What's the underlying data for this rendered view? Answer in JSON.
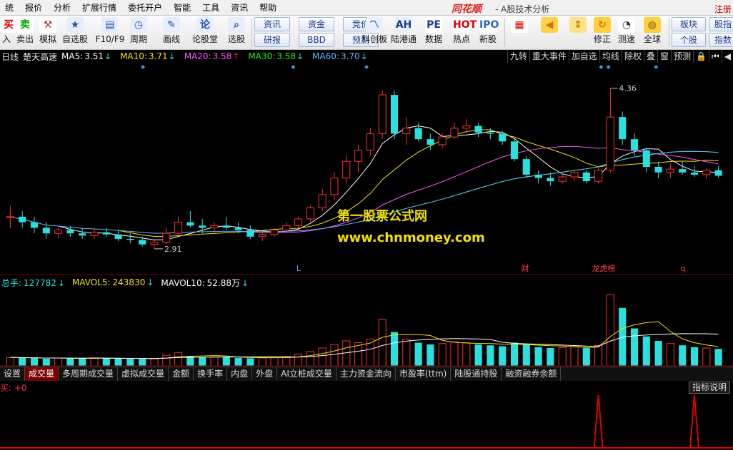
{
  "menu": [
    "统",
    "报价",
    "分析",
    "扩展行情",
    "委托开户",
    "智能",
    "工具",
    "资讯",
    "帮助"
  ],
  "brand": {
    "name": "同花顺",
    "subtitle": "- A股技术分析",
    "right_link": "注册"
  },
  "toolbar": {
    "left_buttons": [
      {
        "icon": "buy-icon",
        "glyph": "买",
        "label": "入"
      },
      {
        "icon": "sell-icon",
        "glyph": "卖",
        "label": "卖出"
      },
      {
        "icon": "hammer-icon",
        "glyph": "⚒",
        "label": "模拟"
      },
      {
        "icon": "star-icon",
        "glyph": "★",
        "label": "自选股"
      },
      {
        "icon": "f10-icon",
        "glyph": "▤",
        "label": "F10/F9"
      },
      {
        "icon": "clock-icon",
        "glyph": "◷",
        "label": "周期"
      },
      {
        "icon": "pencil-icon",
        "glyph": "✎",
        "label": "画线"
      },
      {
        "icon": "forum-icon",
        "glyph": "论",
        "label": "论股堂"
      },
      {
        "icon": "magnifier-icon",
        "glyph": "⌕",
        "label": "选股"
      }
    ],
    "small_buttons": [
      [
        "资讯",
        "研报"
      ],
      [
        "资金",
        "BBD"
      ],
      [
        "竞价",
        "预测"
      ]
    ],
    "right_buttons": [
      {
        "icon": "kcb-icon",
        "glyph": "〽",
        "label": "科创板"
      },
      {
        "icon": "ah-icon",
        "glyph": "AH",
        "label": "陆港通"
      },
      {
        "icon": "pe-icon",
        "glyph": "PE",
        "label": "数据"
      },
      {
        "icon": "hot-icon",
        "glyph": "HOT",
        "label": "热点"
      },
      {
        "icon": "ipo-icon",
        "glyph": "IPO",
        "label": "新股"
      }
    ],
    "nav_buttons": [
      {
        "icon": "grid-icon",
        "glyph": "▦",
        "label": ""
      },
      {
        "icon": "back-arrow-icon",
        "glyph": "◀",
        "label": ""
      },
      {
        "icon": "updown-icon",
        "glyph": "⇕",
        "label": ""
      },
      {
        "icon": "revise-icon",
        "glyph": "↻",
        "label": "修正"
      },
      {
        "icon": "speed-icon",
        "glyph": "◔",
        "label": "测速"
      },
      {
        "icon": "globe-icon",
        "glyph": "◍",
        "label": "全球"
      }
    ],
    "far_right": [
      [
        "板块",
        "个股"
      ],
      [
        "股指",
        "指数"
      ]
    ]
  },
  "kline": {
    "period": "日线",
    "name": "楚天高速",
    "ma": [
      {
        "label": "MA5:",
        "value": "3.51",
        "dir": "↓",
        "color": "#ffffff"
      },
      {
        "label": "MA10:",
        "value": "3.71",
        "dir": "↓",
        "color": "#f5e100"
      },
      {
        "label": "MA20:",
        "value": "3.58",
        "dir": "↑",
        "color": "#ff55ff"
      },
      {
        "label": "MA30:",
        "value": "3.58",
        "dir": "↓",
        "color": "#22ee22"
      },
      {
        "label": "MA60:",
        "value": "3.70",
        "dir": "↓",
        "color": "#55bbff"
      }
    ],
    "tabs": [
      "九转",
      "重大事件",
      "加自选",
      "均线",
      "除权",
      "叠",
      "窗",
      "预测",
      "🔒",
      "⏮",
      "◀"
    ],
    "high_label": "4.36",
    "low_label": "2.91",
    "event_marks": [
      {
        "text": "L",
        "color": "#5aa0ff"
      },
      {
        "text": "财",
        "color": "#ff4040"
      },
      {
        "text": "龙虎榜",
        "color": "#ff4040"
      },
      {
        "text": "q",
        "color": "#ff4040"
      }
    ],
    "colors": {
      "up": "#ff3030",
      "down": "#28e0e0"
    }
  },
  "watermark": {
    "line1": "第一股票公式网",
    "line2": "www.chnmoney.com"
  },
  "volume": {
    "items": [
      {
        "label": "总手:",
        "value": "127782",
        "dir": "↓",
        "color": "#28e0e0"
      },
      {
        "label": "MAVOL5:",
        "value": "243830",
        "dir": "↓",
        "color": "#f5e100"
      },
      {
        "label": "MAVOL10:",
        "value": "52.88万",
        "dir": "↓",
        "color": "#ffffff"
      }
    ]
  },
  "indicator_tabs": [
    "设置",
    "成交量",
    "多周期成交量",
    "虚拟成交量",
    "金额",
    "换手率",
    "内盘",
    "外盘",
    "AI立桩成交量",
    "主力资金流向",
    "市盈率(ttm)",
    "陆股通持股",
    "融资融券余额"
  ],
  "indicator": {
    "label": "买: +0",
    "desc_button": "指标说明"
  },
  "chart_data": {
    "type": "candlestick",
    "ohlc": [
      [
        3.2,
        3.3,
        3.1,
        3.2
      ],
      [
        3.2,
        3.25,
        3.1,
        3.15
      ],
      [
        3.15,
        3.2,
        3.05,
        3.1
      ],
      [
        3.1,
        3.15,
        3.0,
        3.05
      ],
      [
        3.05,
        3.1,
        3.0,
        3.08
      ],
      [
        3.08,
        3.12,
        3.02,
        3.05
      ],
      [
        3.05,
        3.1,
        3.0,
        3.03
      ],
      [
        3.03,
        3.1,
        3.0,
        3.06
      ],
      [
        3.06,
        3.1,
        3.02,
        3.04
      ],
      [
        3.04,
        3.08,
        2.98,
        3.0
      ],
      [
        3.0,
        3.05,
        2.96,
        2.99
      ],
      [
        2.99,
        3.02,
        2.93,
        2.95
      ],
      [
        2.95,
        3.0,
        2.91,
        2.97
      ],
      [
        2.97,
        3.1,
        2.95,
        3.05
      ],
      [
        3.05,
        3.2,
        3.03,
        3.15
      ],
      [
        3.15,
        3.25,
        3.1,
        3.12
      ],
      [
        3.12,
        3.18,
        3.05,
        3.1
      ],
      [
        3.1,
        3.15,
        3.05,
        3.12
      ],
      [
        3.12,
        3.2,
        3.08,
        3.1
      ],
      [
        3.1,
        3.15,
        3.05,
        3.08
      ],
      [
        3.08,
        3.12,
        3.0,
        3.02
      ],
      [
        3.02,
        3.06,
        2.98,
        3.04
      ],
      [
        3.04,
        3.1,
        3.02,
        3.08
      ],
      [
        3.08,
        3.15,
        3.06,
        3.12
      ],
      [
        3.12,
        3.2,
        3.1,
        3.18
      ],
      [
        3.18,
        3.3,
        3.15,
        3.28
      ],
      [
        3.28,
        3.45,
        3.25,
        3.4
      ],
      [
        3.4,
        3.6,
        3.35,
        3.55
      ],
      [
        3.55,
        3.75,
        3.5,
        3.7
      ],
      [
        3.7,
        3.85,
        3.6,
        3.8
      ],
      [
        3.8,
        4.0,
        3.75,
        3.95
      ],
      [
        3.95,
        4.34,
        3.9,
        4.3
      ],
      [
        4.3,
        4.34,
        3.9,
        3.95
      ],
      [
        3.95,
        4.1,
        3.85,
        4.0
      ],
      [
        4.0,
        4.05,
        3.88,
        3.9
      ],
      [
        3.9,
        3.95,
        3.8,
        3.85
      ],
      [
        3.85,
        3.95,
        3.82,
        3.92
      ],
      [
        3.92,
        4.05,
        3.9,
        4.0
      ],
      [
        4.0,
        4.08,
        3.95,
        4.02
      ],
      [
        4.02,
        4.05,
        3.92,
        3.96
      ],
      [
        3.96,
        4.0,
        3.9,
        3.95
      ],
      [
        3.95,
        3.98,
        3.85,
        3.88
      ],
      [
        3.88,
        3.9,
        3.7,
        3.72
      ],
      [
        3.72,
        3.75,
        3.55,
        3.58
      ],
      [
        3.58,
        3.62,
        3.5,
        3.55
      ],
      [
        3.55,
        3.6,
        3.48,
        3.52
      ],
      [
        3.52,
        3.58,
        3.5,
        3.56
      ],
      [
        3.56,
        3.62,
        3.52,
        3.6
      ],
      [
        3.6,
        3.62,
        3.5,
        3.52
      ],
      [
        3.52,
        3.65,
        3.5,
        3.62
      ],
      [
        3.62,
        4.36,
        3.6,
        4.1
      ],
      [
        4.1,
        4.15,
        3.85,
        3.9
      ],
      [
        3.9,
        3.95,
        3.75,
        3.8
      ],
      [
        3.8,
        3.82,
        3.6,
        3.65
      ],
      [
        3.65,
        3.7,
        3.55,
        3.6
      ],
      [
        3.6,
        3.68,
        3.55,
        3.63
      ],
      [
        3.63,
        3.7,
        3.58,
        3.6
      ],
      [
        3.6,
        3.66,
        3.56,
        3.58
      ],
      [
        3.58,
        3.64,
        3.54,
        3.62
      ],
      [
        3.62,
        3.66,
        3.55,
        3.57
      ]
    ],
    "volume": [
      95,
      90,
      85,
      80,
      88,
      82,
      86,
      90,
      84,
      80,
      78,
      76,
      82,
      120,
      150,
      110,
      95,
      100,
      98,
      90,
      85,
      88,
      92,
      105,
      130,
      160,
      200,
      240,
      280,
      260,
      300,
      520,
      380,
      300,
      260,
      240,
      250,
      270,
      260,
      240,
      230,
      220,
      260,
      240,
      210,
      200,
      205,
      215,
      200,
      230,
      800,
      650,
      420,
      330,
      280,
      250,
      230,
      210,
      200,
      190
    ],
    "ylim": [
      2.8,
      4.5
    ],
    "signals": [
      49,
      57
    ]
  }
}
